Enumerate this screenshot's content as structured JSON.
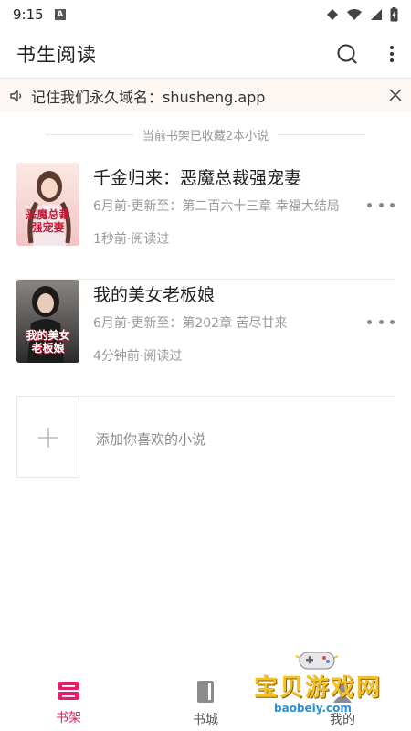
{
  "status": {
    "time": "9:15",
    "indicator": "A"
  },
  "app_bar": {
    "title": "书生阅读",
    "search_icon": "search-icon",
    "more_icon": "more-vertical-icon"
  },
  "notice": {
    "text": "记住我们永久域名：shusheng.app"
  },
  "shelf": {
    "count_text": "当前书架已收藏2本小说"
  },
  "books": [
    {
      "title": "千金归来：恶魔总裁强宠妻",
      "meta": "6月前·更新至：第二百六十三章 幸福大结局",
      "read": "1秒前·阅读过",
      "cover_text": "恶魔总裁\n强宠妻",
      "cover_colors": {
        "bg": "#f6d9d7",
        "accent": "#c21f3a"
      }
    },
    {
      "title": "我的美女老板娘",
      "meta": "6月前·更新至：第202章 苦尽甘来",
      "read": "4分钟前·阅读过",
      "cover_text": "我的美女\n老板娘",
      "cover_colors": {
        "bg": "#3a3a3a",
        "accent": "#e03a3a"
      }
    }
  ],
  "add_book": {
    "text": "添加你喜欢的小说"
  },
  "nav": [
    {
      "label": "书架",
      "active": true
    },
    {
      "label": "书城",
      "active": false
    },
    {
      "label": "我的",
      "active": false
    }
  ],
  "watermark": {
    "text": "宝贝游戏网",
    "url": "baobeiy.com"
  },
  "colors": {
    "accent": "#e0206a",
    "notice_bg": "#fcf7f3"
  }
}
